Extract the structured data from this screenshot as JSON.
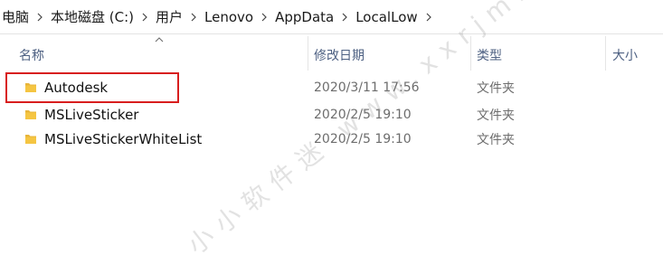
{
  "breadcrumb": [
    {
      "label": "电脑"
    },
    {
      "label": "本地磁盘 (C:)"
    },
    {
      "label": "用户"
    },
    {
      "label": "Lenovo"
    },
    {
      "label": "AppData"
    },
    {
      "label": "LocalLow"
    }
  ],
  "columns": {
    "name": "名称",
    "date": "修改日期",
    "type": "类型",
    "size": "大小"
  },
  "rows": [
    {
      "name": "Autodesk",
      "date": "2020/3/11 17:56",
      "type": "文件夹",
      "icon": "folder-icon"
    },
    {
      "name": "MSLiveSticker",
      "date": "2020/2/5 19:10",
      "type": "文件夹",
      "icon": "folder-icon"
    },
    {
      "name": "MSLiveStickerWhiteList",
      "date": "2020/2/5 19:10",
      "type": "文件夹",
      "icon": "folder-icon"
    }
  ],
  "watermark": "小小软件迷 www.xxrjm.com",
  "colors": {
    "highlight": "#d81e1e",
    "folder": "#f5c542",
    "header_text": "#4d6082"
  }
}
